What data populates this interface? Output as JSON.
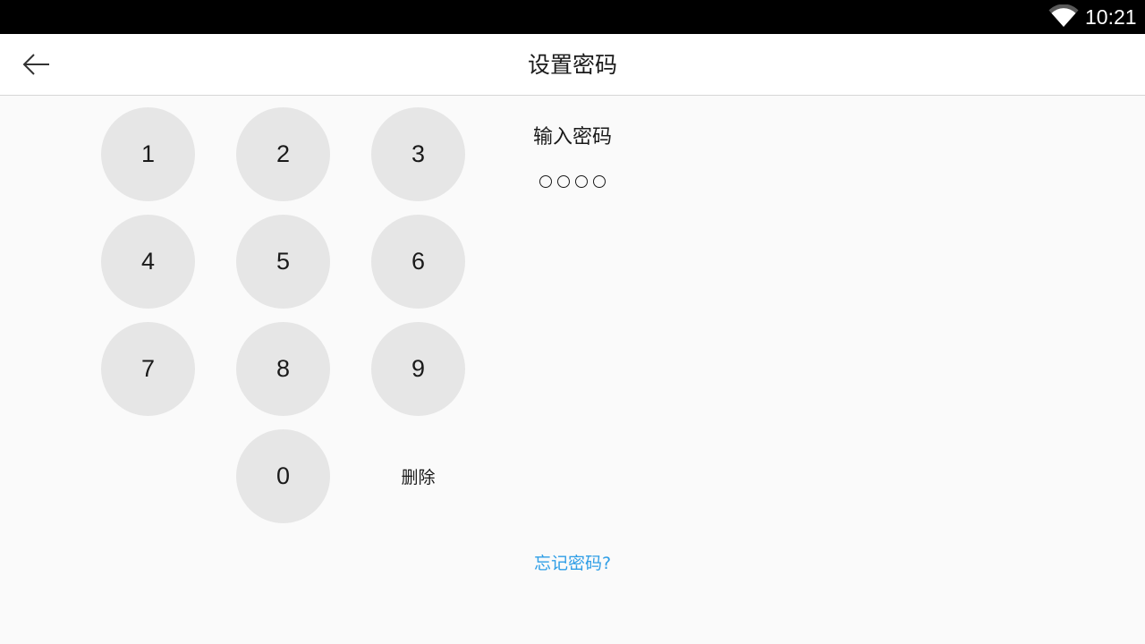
{
  "status_bar": {
    "time": "10:21",
    "wifi_icon": "wifi-icon"
  },
  "header": {
    "title": "设置密码",
    "back_icon": "arrow-left-icon"
  },
  "keypad": {
    "keys": [
      "1",
      "2",
      "3",
      "4",
      "5",
      "6",
      "7",
      "8",
      "9",
      "0"
    ],
    "delete_label": "删除"
  },
  "pin_entry": {
    "prompt": "输入密码",
    "length": 4,
    "filled": 0
  },
  "forgot_link": "忘记密码?",
  "colors": {
    "status_bar": "#000000",
    "background": "#fafafa",
    "key_fill": "#e6e6e6",
    "link": "#2f9ee6"
  }
}
